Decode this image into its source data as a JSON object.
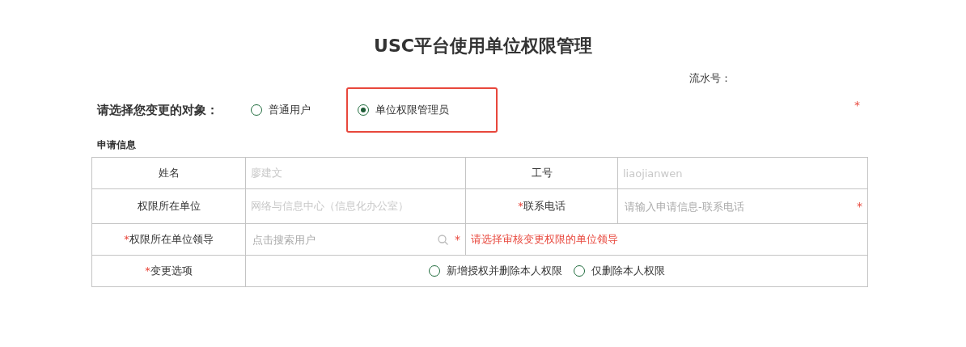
{
  "title": "USC平台使用单位权限管理",
  "serial": {
    "label": "流水号："
  },
  "target": {
    "label": "请选择您变更的对象：",
    "required_mark": "*",
    "options": [
      {
        "label": "普通用户",
        "selected": false,
        "highlighted": false
      },
      {
        "label": "单位权限管理员",
        "selected": true,
        "highlighted": true
      }
    ]
  },
  "section_title": "申请信息",
  "form": {
    "name": {
      "label": "姓名",
      "value": "廖建文"
    },
    "job_number": {
      "label": "工号",
      "value": "liaojianwen"
    },
    "unit": {
      "label": "权限所在单位",
      "value": "网络与信息中心（信息化办公室）"
    },
    "phone": {
      "label": "联系电话",
      "required_mark": "*",
      "placeholder": "请输入申请信息-联系电话",
      "field_mark": "*"
    },
    "leader": {
      "label": "权限所在单位领导",
      "required_mark": "*",
      "placeholder": "点击搜索用户",
      "field_mark": "*",
      "error": "请选择审核变更权限的单位领导"
    },
    "change": {
      "label": "变更选项",
      "required_mark": "*",
      "options": [
        {
          "label": "新增授权并删除本人权限",
          "selected": false
        },
        {
          "label": "仅删除本人权限",
          "selected": false
        }
      ]
    }
  }
}
